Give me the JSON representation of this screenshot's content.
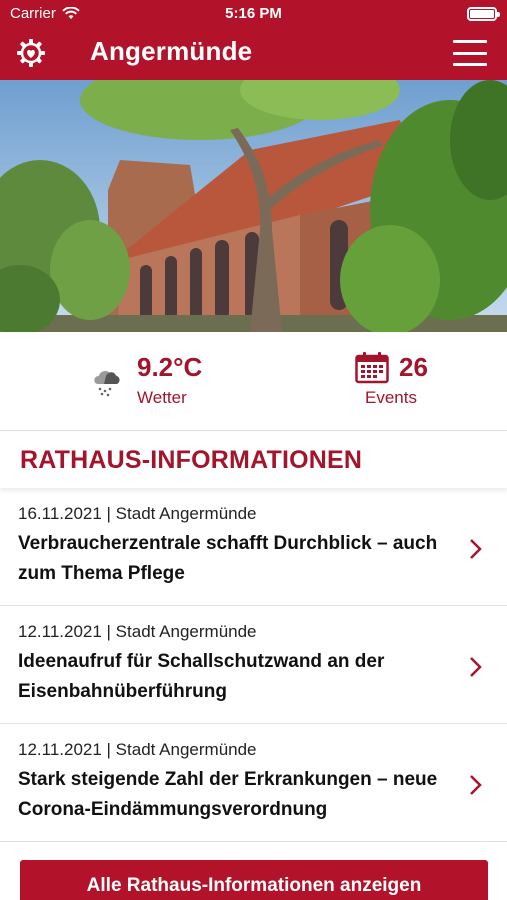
{
  "status_bar": {
    "carrier": "Carrier",
    "time": "5:16 PM"
  },
  "header": {
    "title": "Angermünde",
    "left_icon": "heart-gear-icon",
    "right_icon": "hamburger-menu-icon"
  },
  "hero": {
    "subject": "church-photo"
  },
  "stats": {
    "weather": {
      "value": "9.2°C",
      "label": "Wetter",
      "icon": "cloud-rain-icon"
    },
    "events": {
      "value": "26",
      "label": "Events",
      "icon": "calendar-icon"
    }
  },
  "section": {
    "title": "RATHAUS-INFORMATIONEN"
  },
  "news": [
    {
      "meta": "16.11.2021 | Stadt Angermünde",
      "title": "Verbraucherzentrale schafft Durchblick – auch zum Thema Pflege"
    },
    {
      "meta": "12.11.2021 | Stadt Angermünde",
      "title": "Ideenaufruf für Schallschutzwand an der Eisenbahnüberführung"
    },
    {
      "meta": "12.11.2021 | Stadt Angermünde",
      "title": "Stark steigende Zahl der Erkrankungen – neue Corona-Eindämmungsverordnung"
    }
  ],
  "cta": {
    "label": "Alle Rathaus-Informationen anzeigen"
  },
  "colors": {
    "brand": "#b2132a",
    "accent_text": "#a3152c"
  }
}
